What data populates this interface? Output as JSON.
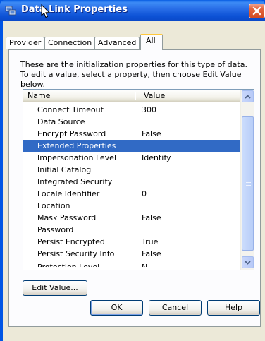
{
  "window": {
    "title": "Data Link Properties",
    "app_icon": "datalink-icon",
    "close_icon": "close-icon"
  },
  "tabs": [
    {
      "label": "Provider",
      "active": false
    },
    {
      "label": "Connection",
      "active": false
    },
    {
      "label": "Advanced",
      "active": false
    },
    {
      "label": "All",
      "active": true
    }
  ],
  "description": "These are the initialization properties for this type of data. To edit a value, select a property, then choose Edit Value below.",
  "list": {
    "columns": [
      "Name",
      "Value"
    ],
    "rows": [
      {
        "name": "Connect Timeout",
        "value": "300"
      },
      {
        "name": "Data Source",
        "value": ""
      },
      {
        "name": "Encrypt Password",
        "value": "False"
      },
      {
        "name": "Extended Properties",
        "value": ""
      },
      {
        "name": "Impersonation Level",
        "value": "Identify"
      },
      {
        "name": "Initial Catalog",
        "value": ""
      },
      {
        "name": "Integrated Security",
        "value": ""
      },
      {
        "name": "Locale Identifier",
        "value": "0"
      },
      {
        "name": "Location",
        "value": ""
      },
      {
        "name": "Mask Password",
        "value": "False"
      },
      {
        "name": "Password",
        "value": ""
      },
      {
        "name": "Persist Encrypted",
        "value": "True"
      },
      {
        "name": "Persist Security Info",
        "value": "False"
      },
      {
        "name": "Protection Level",
        "value": "N..."
      }
    ],
    "selected_row": "Extended Properties"
  },
  "buttons": {
    "edit_value": "Edit Value...",
    "ok": "OK",
    "cancel": "Cancel",
    "help": "Help"
  },
  "colors": {
    "titlebar": "#0a49c9",
    "selection": "#316ac5",
    "dialog_face": "#ece9d8",
    "close_button": "#d24a22"
  }
}
